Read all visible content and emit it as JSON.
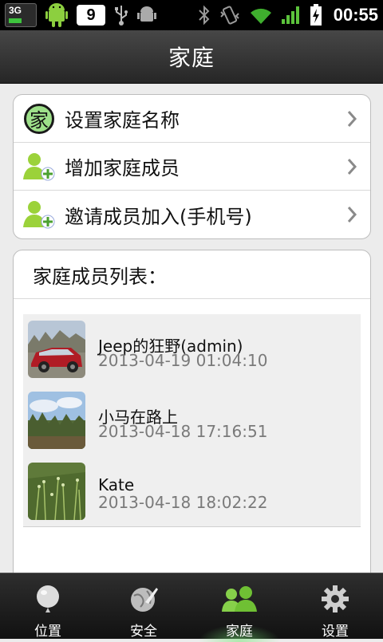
{
  "status_bar": {
    "network": "3G",
    "notification_count": "9",
    "time": "00:55"
  },
  "title_bar": {
    "title": "家庭"
  },
  "menu": {
    "items": [
      {
        "label": "设置家庭名称",
        "icon": "home-char-icon",
        "icon_text": "家"
      },
      {
        "label": "增加家庭成员",
        "icon": "add-user-icon"
      },
      {
        "label": "邀请成员加入(手机号)",
        "icon": "add-user-icon"
      }
    ]
  },
  "members_list": {
    "header": "家庭成员列表：",
    "members": [
      {
        "name": "Jeep的狂野(admin)",
        "time": "2013-04-19 01:04:10",
        "avatar": "red-car-photo"
      },
      {
        "name": "小马在路上",
        "time": "2013-04-18 17:16:51",
        "avatar": "trees-sky-photo"
      },
      {
        "name": "Kate",
        "time": "2013-04-18 18:02:22",
        "avatar": "green-field-photo"
      }
    ]
  },
  "tab_bar": {
    "active_index": 2,
    "tabs": [
      {
        "label": "位置",
        "icon": "balloon-icon"
      },
      {
        "label": "安全",
        "icon": "security-globe-icon"
      },
      {
        "label": "家庭",
        "icon": "family-icon"
      },
      {
        "label": "设置",
        "icon": "gear-icon"
      }
    ]
  },
  "colors": {
    "accent_green": "#7fcf3a",
    "title_bar": "#333333",
    "timestamp_gray": "#7a7a7a"
  }
}
